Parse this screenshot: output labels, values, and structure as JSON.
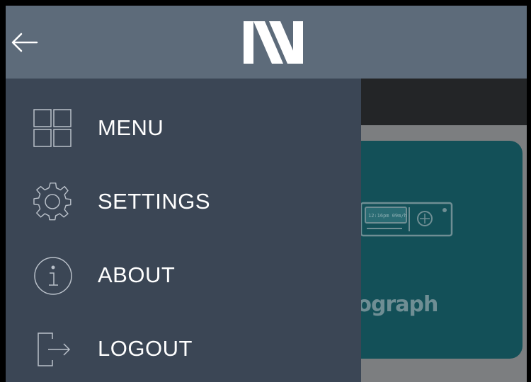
{
  "topbar": {
    "back_icon": "arrow-left-icon",
    "logo": "brand-logo"
  },
  "drawer": {
    "items": [
      {
        "label": "MENU",
        "icon": "grid-icon"
      },
      {
        "label": "SETTINGS",
        "icon": "gear-icon"
      },
      {
        "label": "ABOUT",
        "icon": "info-icon"
      },
      {
        "label": "LOGOUT",
        "icon": "logout-icon"
      }
    ]
  },
  "card": {
    "label": "achograph",
    "device_icon": "tachograph-device-icon",
    "device_display": "12:16pm  09m/h"
  },
  "colors": {
    "topbar": "#5d6b7a",
    "drawer": "#3b4655",
    "card": "#135058",
    "overlay": "#7c7e80"
  }
}
